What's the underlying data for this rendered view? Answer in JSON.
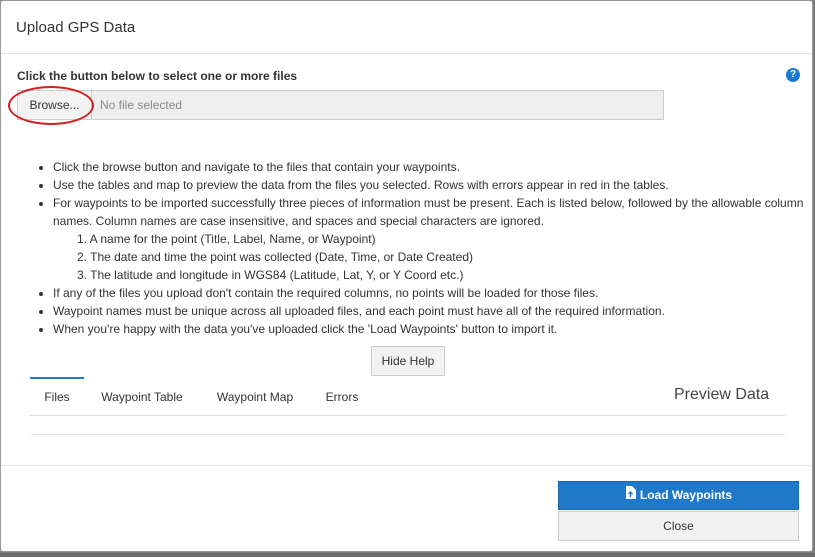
{
  "modal": {
    "title": "Upload GPS Data",
    "instruction": "Click the button below to select one or more files",
    "help_icon": "question-circle-icon",
    "browse_label": "Browse...",
    "file_status": "No file selected",
    "help_items": [
      "Click the browse button and navigate to the files that contain your waypoints.",
      "Use the tables and map to preview the data from the files you selected. Rows with errors appear in red in the tables.",
      "For waypoints to be imported successfully three pieces of information must be present. Each is listed below, followed by the allowable column names. Column names are case insensitive, and spaces and special characters are ignored.",
      "If any of the files you upload don't contain the required columns, no points will be loaded for those files.",
      "Waypoint names must be unique across all uploaded files, and each point must have all of the required information.",
      "When you're happy with the data you've uploaded click the 'Load Waypoints' button to import it."
    ],
    "required_fields": [
      "1. A name for the point (Title, Label, Name, or Waypoint)",
      "2. The date and time the point was collected (Date, Time, or Date Created)",
      "3. The latitude and longitude in WGS84 (Latitude, Lat, Y, or Y Coord etc.)"
    ],
    "hide_help_label": "Hide Help",
    "tabs": [
      "Files",
      "Waypoint Table",
      "Waypoint Map",
      "Errors"
    ],
    "active_tab": "Files",
    "preview_title": "Preview Data",
    "load_label": "Load Waypoints",
    "close_label": "Close"
  },
  "colors": {
    "accent": "#1f78c8",
    "highlight_ellipse": "#d42020"
  }
}
